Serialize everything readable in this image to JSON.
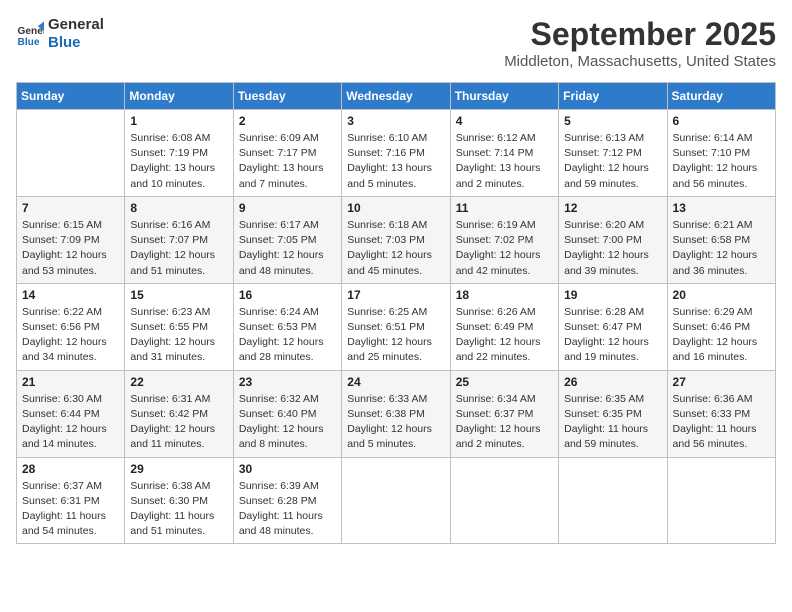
{
  "logo": {
    "line1": "General",
    "line2": "Blue"
  },
  "title": "September 2025",
  "subtitle": "Middleton, Massachusetts, United States",
  "weekdays": [
    "Sunday",
    "Monday",
    "Tuesday",
    "Wednesday",
    "Thursday",
    "Friday",
    "Saturday"
  ],
  "weeks": [
    [
      {
        "day": "",
        "info": ""
      },
      {
        "day": "1",
        "info": "Sunrise: 6:08 AM\nSunset: 7:19 PM\nDaylight: 13 hours\nand 10 minutes."
      },
      {
        "day": "2",
        "info": "Sunrise: 6:09 AM\nSunset: 7:17 PM\nDaylight: 13 hours\nand 7 minutes."
      },
      {
        "day": "3",
        "info": "Sunrise: 6:10 AM\nSunset: 7:16 PM\nDaylight: 13 hours\nand 5 minutes."
      },
      {
        "day": "4",
        "info": "Sunrise: 6:12 AM\nSunset: 7:14 PM\nDaylight: 13 hours\nand 2 minutes."
      },
      {
        "day": "5",
        "info": "Sunrise: 6:13 AM\nSunset: 7:12 PM\nDaylight: 12 hours\nand 59 minutes."
      },
      {
        "day": "6",
        "info": "Sunrise: 6:14 AM\nSunset: 7:10 PM\nDaylight: 12 hours\nand 56 minutes."
      }
    ],
    [
      {
        "day": "7",
        "info": "Sunrise: 6:15 AM\nSunset: 7:09 PM\nDaylight: 12 hours\nand 53 minutes."
      },
      {
        "day": "8",
        "info": "Sunrise: 6:16 AM\nSunset: 7:07 PM\nDaylight: 12 hours\nand 51 minutes."
      },
      {
        "day": "9",
        "info": "Sunrise: 6:17 AM\nSunset: 7:05 PM\nDaylight: 12 hours\nand 48 minutes."
      },
      {
        "day": "10",
        "info": "Sunrise: 6:18 AM\nSunset: 7:03 PM\nDaylight: 12 hours\nand 45 minutes."
      },
      {
        "day": "11",
        "info": "Sunrise: 6:19 AM\nSunset: 7:02 PM\nDaylight: 12 hours\nand 42 minutes."
      },
      {
        "day": "12",
        "info": "Sunrise: 6:20 AM\nSunset: 7:00 PM\nDaylight: 12 hours\nand 39 minutes."
      },
      {
        "day": "13",
        "info": "Sunrise: 6:21 AM\nSunset: 6:58 PM\nDaylight: 12 hours\nand 36 minutes."
      }
    ],
    [
      {
        "day": "14",
        "info": "Sunrise: 6:22 AM\nSunset: 6:56 PM\nDaylight: 12 hours\nand 34 minutes."
      },
      {
        "day": "15",
        "info": "Sunrise: 6:23 AM\nSunset: 6:55 PM\nDaylight: 12 hours\nand 31 minutes."
      },
      {
        "day": "16",
        "info": "Sunrise: 6:24 AM\nSunset: 6:53 PM\nDaylight: 12 hours\nand 28 minutes."
      },
      {
        "day": "17",
        "info": "Sunrise: 6:25 AM\nSunset: 6:51 PM\nDaylight: 12 hours\nand 25 minutes."
      },
      {
        "day": "18",
        "info": "Sunrise: 6:26 AM\nSunset: 6:49 PM\nDaylight: 12 hours\nand 22 minutes."
      },
      {
        "day": "19",
        "info": "Sunrise: 6:28 AM\nSunset: 6:47 PM\nDaylight: 12 hours\nand 19 minutes."
      },
      {
        "day": "20",
        "info": "Sunrise: 6:29 AM\nSunset: 6:46 PM\nDaylight: 12 hours\nand 16 minutes."
      }
    ],
    [
      {
        "day": "21",
        "info": "Sunrise: 6:30 AM\nSunset: 6:44 PM\nDaylight: 12 hours\nand 14 minutes."
      },
      {
        "day": "22",
        "info": "Sunrise: 6:31 AM\nSunset: 6:42 PM\nDaylight: 12 hours\nand 11 minutes."
      },
      {
        "day": "23",
        "info": "Sunrise: 6:32 AM\nSunset: 6:40 PM\nDaylight: 12 hours\nand 8 minutes."
      },
      {
        "day": "24",
        "info": "Sunrise: 6:33 AM\nSunset: 6:38 PM\nDaylight: 12 hours\nand 5 minutes."
      },
      {
        "day": "25",
        "info": "Sunrise: 6:34 AM\nSunset: 6:37 PM\nDaylight: 12 hours\nand 2 minutes."
      },
      {
        "day": "26",
        "info": "Sunrise: 6:35 AM\nSunset: 6:35 PM\nDaylight: 11 hours\nand 59 minutes."
      },
      {
        "day": "27",
        "info": "Sunrise: 6:36 AM\nSunset: 6:33 PM\nDaylight: 11 hours\nand 56 minutes."
      }
    ],
    [
      {
        "day": "28",
        "info": "Sunrise: 6:37 AM\nSunset: 6:31 PM\nDaylight: 11 hours\nand 54 minutes."
      },
      {
        "day": "29",
        "info": "Sunrise: 6:38 AM\nSunset: 6:30 PM\nDaylight: 11 hours\nand 51 minutes."
      },
      {
        "day": "30",
        "info": "Sunrise: 6:39 AM\nSunset: 6:28 PM\nDaylight: 11 hours\nand 48 minutes."
      },
      {
        "day": "",
        "info": ""
      },
      {
        "day": "",
        "info": ""
      },
      {
        "day": "",
        "info": ""
      },
      {
        "day": "",
        "info": ""
      }
    ]
  ]
}
